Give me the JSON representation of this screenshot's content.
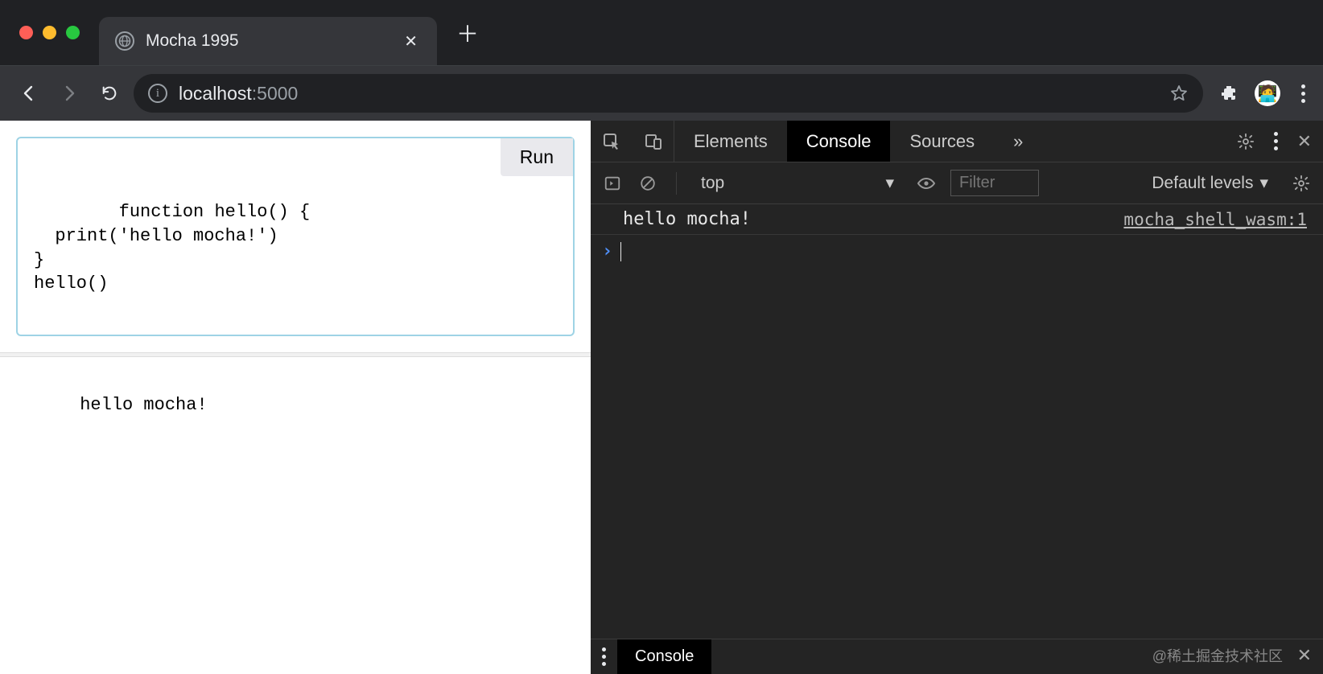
{
  "browser": {
    "tab_title": "Mocha 1995",
    "url_host": "localhost",
    "url_port": ":5000"
  },
  "page": {
    "run_label": "Run",
    "code": "function hello() {\n  print('hello mocha!')\n}\nhello()",
    "output": "hello mocha!"
  },
  "devtools": {
    "tabs": {
      "elements": "Elements",
      "console": "Console",
      "sources": "Sources"
    },
    "context": "top",
    "filter_placeholder": "Filter",
    "levels_label": "Default levels",
    "log_message": "hello mocha!",
    "log_source": "mocha_shell_wasm:1",
    "drawer_tab": "Console",
    "watermark": "@稀土掘金技术社区"
  }
}
